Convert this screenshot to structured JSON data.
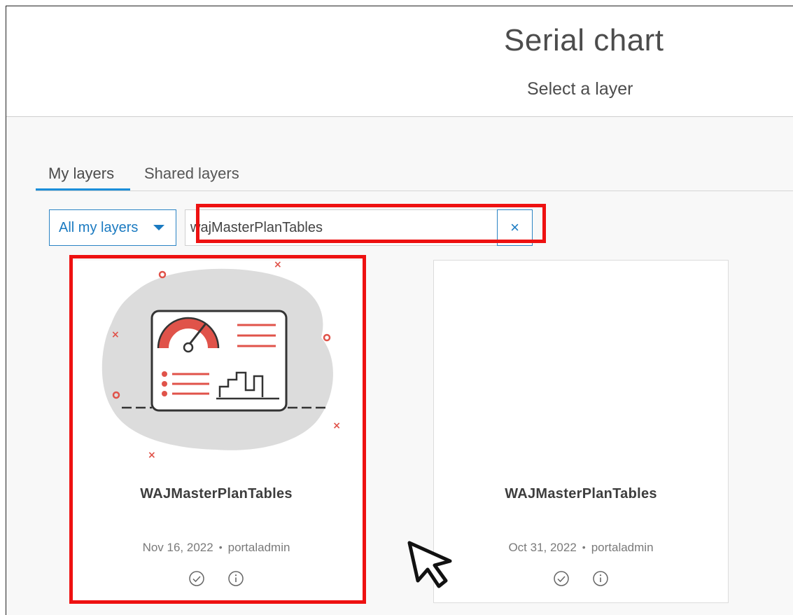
{
  "header": {
    "title": "Serial chart",
    "subtitle": "Select a layer"
  },
  "tabs": [
    {
      "label": "My layers",
      "active": true
    },
    {
      "label": "Shared layers",
      "active": false
    }
  ],
  "filter": {
    "dropdown_label": "All my layers",
    "search_value": "wajMasterPlanTables",
    "clear_icon": "×"
  },
  "cards": [
    {
      "title": "WAJMasterPlanTables",
      "date": "Nov 16, 2022",
      "owner": "portaladmin",
      "separator": "•",
      "thumbnail": "dashboard-illustration",
      "highlighted": true
    },
    {
      "title": "WAJMasterPlanTables",
      "date": "Oct 31, 2022",
      "owner": "portaladmin",
      "separator": "•",
      "thumbnail": "none",
      "highlighted": false
    }
  ],
  "colors": {
    "accent": "#1a7ac1",
    "highlight": "#ee1111",
    "illustration_red": "#e0534a",
    "blob_gray": "#dcdcdc"
  }
}
